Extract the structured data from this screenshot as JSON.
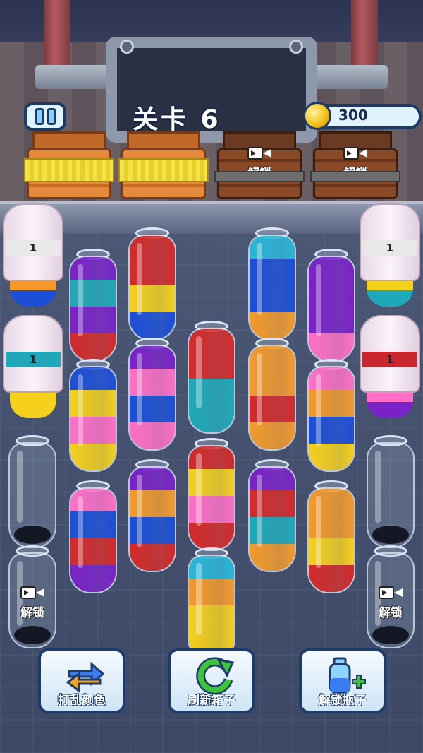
{
  "hud": {
    "level_label": "关卡 6",
    "coins": "300"
  },
  "crates": [
    {
      "state": "filled",
      "color": "#f4e146"
    },
    {
      "state": "filled",
      "color": "#f4e146"
    },
    {
      "state": "locked",
      "label": "解锁"
    },
    {
      "state": "locked",
      "label": "解锁"
    }
  ],
  "covered_bottles": [
    {
      "id": "cov-top-left",
      "tag": "1",
      "tag_color": "#e8e8e8",
      "peek": [
        "#f39a2a",
        "#1c4fd6"
      ]
    },
    {
      "id": "cov-top-right",
      "tag": "1",
      "tag_color": "#e8e8e8",
      "peek": [
        "#f2d21a",
        "#1fa9b8"
      ]
    },
    {
      "id": "cov-mid-left",
      "tag": "1",
      "tag_color": "#22a7b8",
      "peek": [
        "#f5d01c",
        "#f5d01c"
      ]
    },
    {
      "id": "cov-mid-right",
      "tag": "1",
      "tag_color": "#c8282e",
      "peek": [
        "#ff6fc7",
        "#7a22c8"
      ]
    }
  ],
  "bottles": [
    {
      "id": "b1",
      "layers": [
        "#d42a2a",
        "#7a22c8",
        "#1fa9b8",
        "#7a22c8"
      ]
    },
    {
      "id": "b2",
      "layers": [
        "#1c4fd6",
        "#f5d01c",
        "#d42a2a",
        "#d42a2a"
      ]
    },
    {
      "id": "b3",
      "layers": [
        "#f39a2a",
        "#1c4fd6",
        "#1c4fd6",
        "#28b7d8"
      ]
    },
    {
      "id": "b4",
      "layers": [
        "#ff6fc7",
        "#7a22c8",
        "#7a22c8",
        "#7a22c8"
      ]
    },
    {
      "id": "b5",
      "layers": [
        "#f5d01c",
        "#ff6fc7",
        "#f5d01c",
        "#1c4fd6"
      ]
    },
    {
      "id": "b6",
      "layers": [
        "#ff6fc7",
        "#1c4fd6",
        "#ff6fc7",
        "#7a22c8"
      ]
    },
    {
      "id": "b7",
      "layers": [
        "#1fa9b8",
        "#1fa9b8",
        "#d42a2a",
        "#d42a2a"
      ]
    },
    {
      "id": "b8",
      "layers": [
        "#f39a2a",
        "#d42a2a",
        "#f39a2a",
        "#f39a2a"
      ]
    },
    {
      "id": "b9",
      "layers": [
        "#f5d01c",
        "#1c4fd6",
        "#f39a2a",
        "#ff6fc7"
      ]
    },
    {
      "id": "b10",
      "layers": [
        "#7a22c8",
        "#d42a2a",
        "#1c4fd6",
        "#ff6fc7"
      ]
    },
    {
      "id": "b11",
      "layers": [
        "#d42a2a",
        "#1c4fd6",
        "#f39a2a",
        "#7a22c8"
      ]
    },
    {
      "id": "b12",
      "layers": [
        "#d42a2a",
        "#ff6fc7",
        "#f5d01c",
        "#d42a2a"
      ]
    },
    {
      "id": "b13",
      "layers": [
        "#f39a2a",
        "#1fa9b8",
        "#d42a2a",
        "#7a22c8"
      ]
    },
    {
      "id": "b14",
      "layers": [
        "#d42a2a",
        "#f5d01c",
        "#f39a2a",
        "#f39a2a"
      ]
    },
    {
      "id": "b15",
      "layers": [
        "#f5d01c",
        "#f5d01c",
        "#f39a2a",
        "#28b7d8"
      ]
    },
    {
      "id": "empty-left",
      "layers": []
    },
    {
      "id": "empty-right",
      "layers": []
    },
    {
      "id": "lock-left",
      "layers": [],
      "label": "解锁"
    },
    {
      "id": "lock-right",
      "layers": [],
      "label": "解锁"
    }
  ],
  "buttons": {
    "shuffle": "打乱颜色",
    "refresh": "刷新箱子",
    "unlock": "解锁瓶子"
  }
}
